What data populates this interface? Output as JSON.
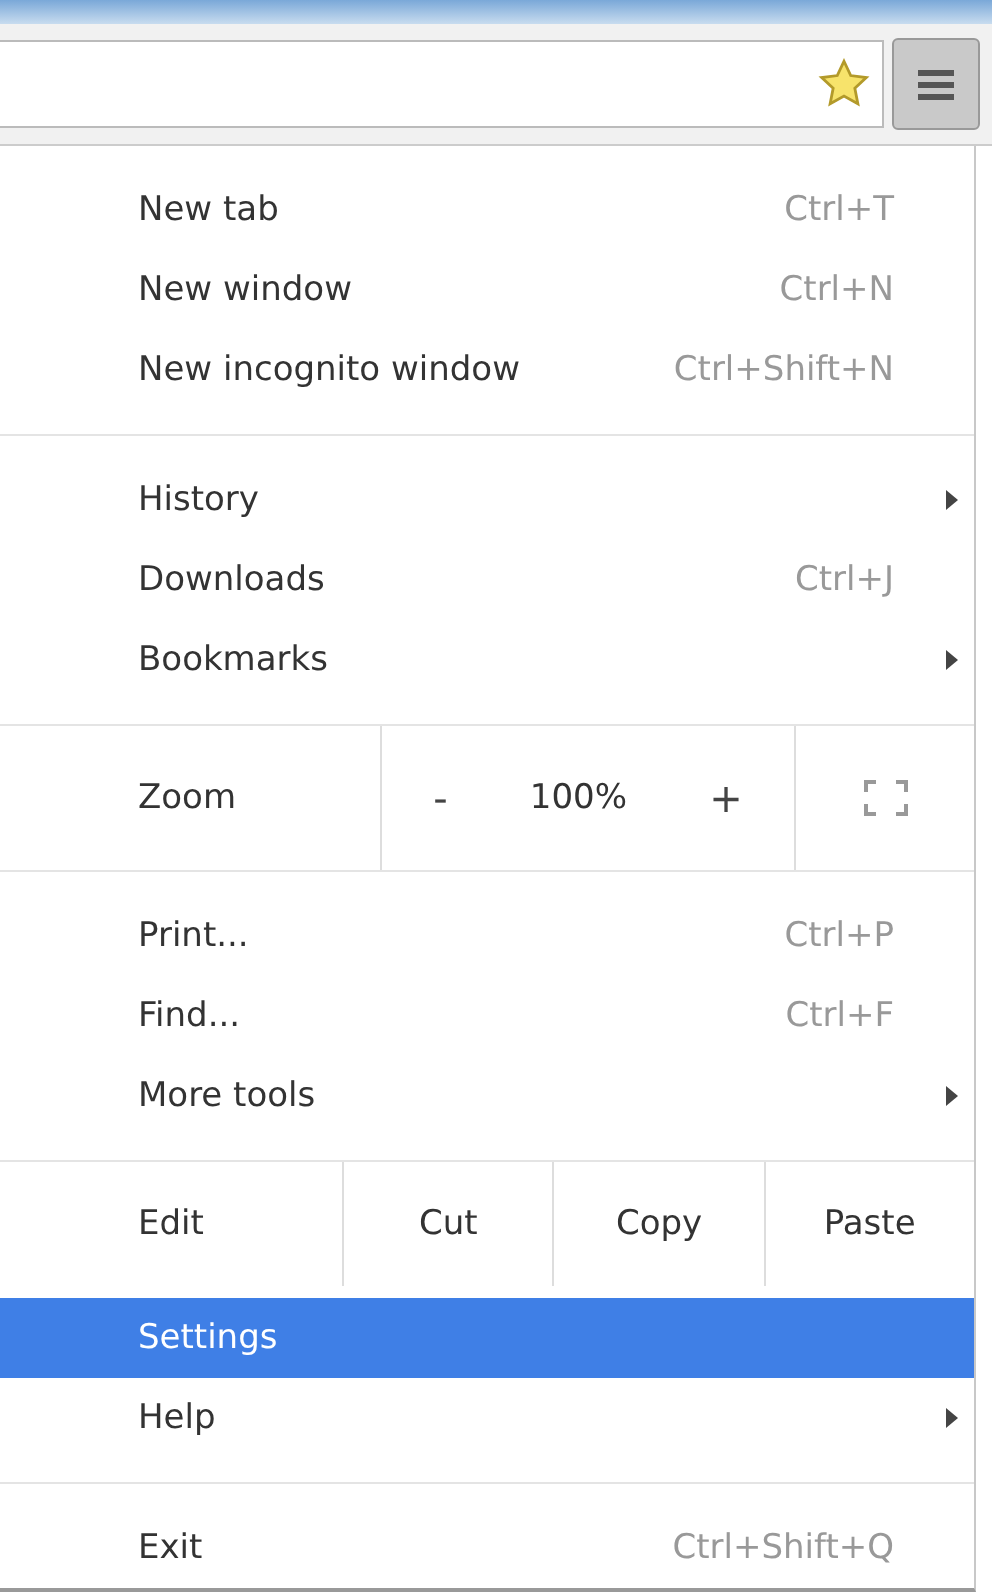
{
  "menu": {
    "sections": [
      {
        "items": [
          {
            "kind": "item",
            "label": "New tab",
            "shortcut": "Ctrl+T",
            "submenu": false,
            "selected": false
          },
          {
            "kind": "item",
            "label": "New window",
            "shortcut": "Ctrl+N",
            "submenu": false,
            "selected": false
          },
          {
            "kind": "item",
            "label": "New incognito window",
            "shortcut": "Ctrl+Shift+N",
            "submenu": false,
            "selected": false
          }
        ]
      },
      {
        "items": [
          {
            "kind": "item",
            "label": "History",
            "submenu": true,
            "selected": false
          },
          {
            "kind": "item",
            "label": "Downloads",
            "shortcut": "Ctrl+J",
            "submenu": false,
            "selected": false
          },
          {
            "kind": "item",
            "label": "Bookmarks",
            "submenu": true,
            "selected": false
          }
        ]
      },
      {
        "items": [
          {
            "kind": "zoom",
            "label": "Zoom",
            "minus": "-",
            "value": "100%",
            "plus": "+"
          }
        ]
      },
      {
        "items": [
          {
            "kind": "item",
            "label": "Print...",
            "shortcut": "Ctrl+P",
            "submenu": false,
            "selected": false
          },
          {
            "kind": "item",
            "label": "Find...",
            "shortcut": "Ctrl+F",
            "submenu": false,
            "selected": false
          },
          {
            "kind": "item",
            "label": "More tools",
            "submenu": true,
            "selected": false
          }
        ]
      },
      {
        "items": [
          {
            "kind": "edit",
            "label": "Edit",
            "buttons": [
              "Cut",
              "Copy",
              "Paste"
            ]
          },
          {
            "kind": "item",
            "label": "Settings",
            "submenu": false,
            "selected": true
          },
          {
            "kind": "item",
            "label": "Help",
            "submenu": true,
            "selected": false
          }
        ]
      },
      {
        "items": [
          {
            "kind": "item",
            "label": "Exit",
            "shortcut": "Ctrl+Shift+Q",
            "submenu": false,
            "selected": false
          }
        ]
      }
    ]
  }
}
